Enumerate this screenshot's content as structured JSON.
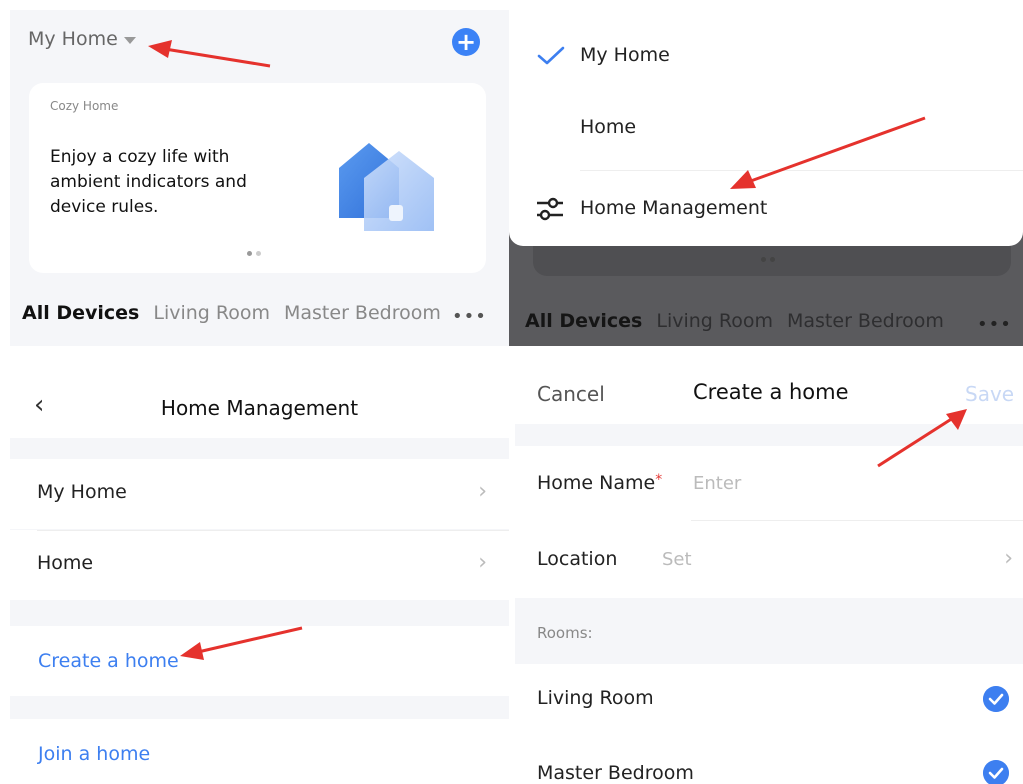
{
  "panel_home": {
    "home_name": "My Home",
    "banner_subtitle": "Cozy Home",
    "banner_text": "Enjoy a cozy life with ambient indicators and device rules.",
    "tabs": [
      "All Devices",
      "Living Room",
      "Master Bedroom"
    ],
    "more": "•••"
  },
  "panel_dropdown": {
    "items": [
      "My Home",
      "Home",
      "Home Management"
    ],
    "tabs": [
      "All Devices",
      "Living Room",
      "Master Bedroom"
    ],
    "more": "•••"
  },
  "panel_management": {
    "title": "Home Management",
    "homes": [
      "My Home",
      "Home"
    ],
    "create_label": "Create a home",
    "join_label": "Join a home"
  },
  "panel_create": {
    "cancel": "Cancel",
    "title": "Create a home",
    "save": "Save",
    "home_name_label": "Home Name",
    "home_name_placeholder": "Enter",
    "location_label": "Location",
    "location_placeholder": "Set",
    "rooms_label": "Rooms:",
    "rooms": [
      "Living Room",
      "Master Bedroom"
    ]
  },
  "colors": {
    "accent": "#3d7ff0",
    "arrow": "#e5322d",
    "required": "#e53935"
  },
  "icons": {
    "add": "plus-circle-icon",
    "selected": "check-icon",
    "manage": "sliders-icon",
    "back": "chevron-left-icon",
    "next": "chevron-right-icon",
    "room_selected": "check-circle-icon"
  }
}
